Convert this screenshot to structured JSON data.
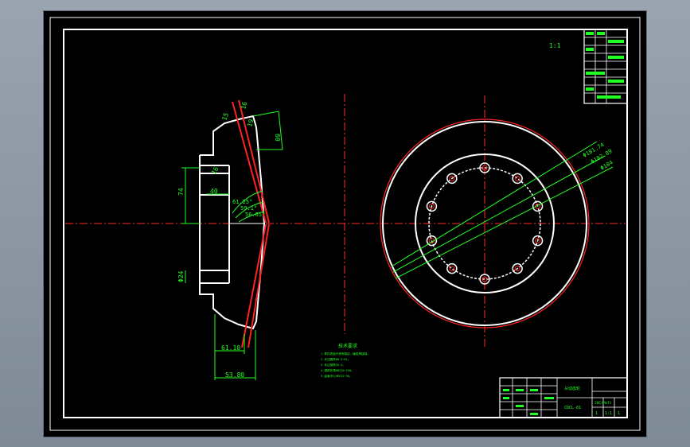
{
  "header": {
    "scale_note": "1:1"
  },
  "section_view": {
    "dim_top_15": "15",
    "dim_top_16": "16",
    "dim_top_19": "19",
    "dim_top_60": "60",
    "dim_16": "16",
    "dim_ang_61": "61.25°",
    "dim_ang_59": "59.1°",
    "dim_ang_56": "56.65°",
    "dim_height_74": "74",
    "dim_hole_24": "Φ24",
    "dim_bottom_61": "61.10",
    "dim_bottom_53": "53.80",
    "dim_small_40": "40"
  },
  "circle_view": {
    "leader_1": "Φ181.74",
    "leader_2": "Φ182.89",
    "leader_3": "Φ184"
  },
  "notes": {
    "title": "技术要求",
    "lines": [
      "1.零件表面不得有裂纹、磕碰等缺陷。",
      "2.未注圆角R0.5~R1。",
      "3.未注倒角C0.5。",
      "4.调质处理HB220~250。",
      "5.齿面淬火HRC52~56。"
    ]
  },
  "title_block": {
    "part_name": "从动齿轮",
    "drawing_no": "CDCL-01",
    "material": "20CrMnTi",
    "count": "1",
    "scale": "1:1",
    "sheet": "1"
  }
}
